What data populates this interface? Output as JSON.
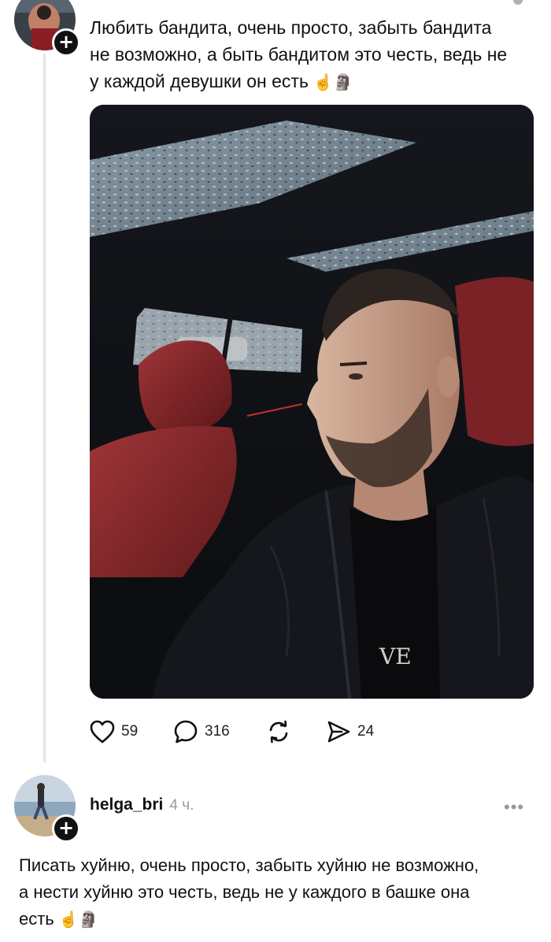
{
  "post1": {
    "text_lines": [
      "Любить бандита, очень просто, забыть бандита",
      "не возможно, а быть бандитом это честь, ведь не",
      "у каждой девушки он есть"
    ],
    "emojis": "☝️🗿",
    "photo_shirt_text": "VE",
    "actions": {
      "likes": "59",
      "comments": "316",
      "reposts": "",
      "shares": "24"
    },
    "icons": [
      "heart-icon",
      "comment-icon",
      "repost-icon",
      "share-icon",
      "plus-icon"
    ]
  },
  "post2": {
    "username": "helga_bri",
    "time": "4 ч.",
    "more": "•••",
    "text_lines": [
      "Писать хуйню, очень просто, забыть хуйню не возможно,",
      "а нести хуйню это честь, ведь не у каждого в башке она",
      "есть"
    ],
    "emojis": "☝️🗿"
  },
  "colors": {
    "text": "#111111",
    "muted": "#9a9a9a",
    "thread_line": "#e4e4e4",
    "seat_red": "#8e2a2e",
    "jacket": "#14151a"
  }
}
